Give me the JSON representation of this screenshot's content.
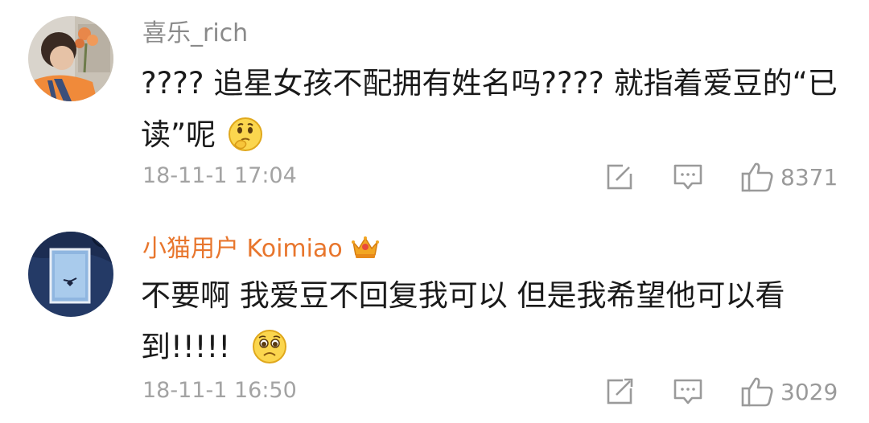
{
  "comments": [
    {
      "username": "喜乐_rich",
      "username_color": "#8a8a8a",
      "text": "???? 追星女孩不配拥有姓名吗???? 就指着爱豆的“已读”呢",
      "emoji": "thinking-emoji",
      "time": "18-11-1 17:04",
      "likes": "8371",
      "icons": [
        "repost-icon",
        "reply-icon",
        "like-icon"
      ]
    },
    {
      "username": "小猫用户 Koimiao",
      "username_color": "#e8762d",
      "badge": "crown-icon",
      "text": "不要啊 我爱豆不回复我可以 但是我希望他可以看到!!!!! ",
      "emoji": "pleading-emoji",
      "time": "18-11-1 16:50",
      "likes": "3029",
      "icons": [
        "repost-icon",
        "reply-icon",
        "like-icon"
      ]
    }
  ]
}
